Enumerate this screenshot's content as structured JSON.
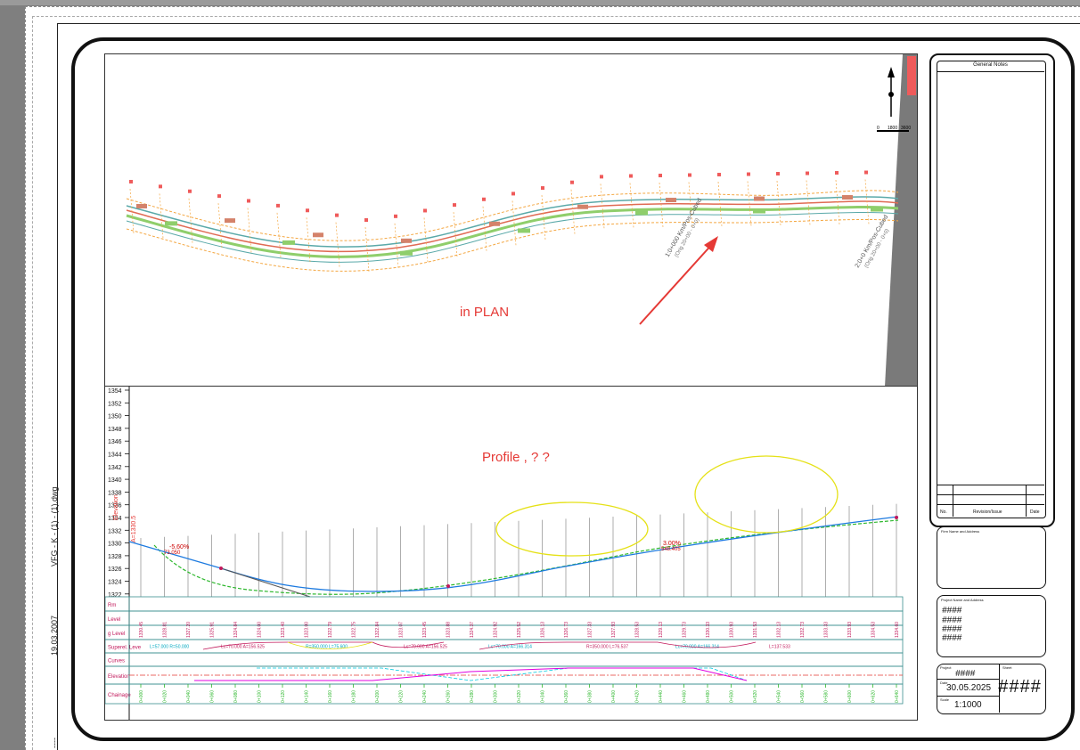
{
  "sheet": {
    "file_name": "VFG - K - (1) - (1).dwg",
    "plot_date": "19.03.2007",
    "side_marks": "----"
  },
  "plan": {
    "annotation": "in PLAN",
    "north_label": "N",
    "scale_bar_labels": [
      "0",
      "1800",
      "3600"
    ],
    "chainage_labels": [
      "1:0+000 Km/Pos-Cubed",
      "(Orig 20+00 - 0+0)",
      "2:0+0 Km/Pos-Cubed",
      "(Orig 20+00 - 0+0)"
    ],
    "road_colors": {
      "edge": "#f4a742",
      "center": "#e06b54",
      "green": "#8fce6b",
      "teal": "#5aa9a9",
      "arrow": "#e53935"
    }
  },
  "profile": {
    "annotation": "Profile ,    ? ?",
    "axis_label": "Elevation",
    "elev_ticks": [
      "1354",
      "1352",
      "1350",
      "1348",
      "1346",
      "1344",
      "1342",
      "1340",
      "1338",
      "1336",
      "1334",
      "1332",
      "1330",
      "1328",
      "1326",
      "1324",
      "1322"
    ],
    "start_label": "A=1330.5",
    "grade_labels": [
      "-5.60%",
      "73.050",
      "3.00%",
      "548.405"
    ],
    "band_labels": [
      "Rm",
      "Level",
      "g Level",
      "Superel. Leve",
      "Curves",
      "Elevation",
      "Chainage"
    ],
    "curve_texts": [
      "L=57.000 R=50.000",
      "Lc=70.000 A=156.525",
      "R=350.000 L=75.600",
      "Lc=70.000 A=156.525",
      "Lc=70.000 A=166.314",
      "R=350.000 L=76.537",
      "Lc=70.000 A=166.314",
      "L=137.533"
    ],
    "chainage_values": [
      "0+000",
      "0+020",
      "0+040",
      "0+060",
      "0+080",
      "0+100",
      "0+120",
      "0+140",
      "0+160",
      "0+180",
      "0+200",
      "0+220",
      "0+240",
      "0+260",
      "0+280",
      "0+300",
      "0+320",
      "0+340",
      "0+360",
      "0+380",
      "0+400",
      "0+420",
      "0+440",
      "0+460",
      "0+480",
      "0+500",
      "0+520",
      "0+540",
      "0+560",
      "0+580",
      "0+600",
      "0+620",
      "0+640"
    ],
    "elevation_values": [
      "1330.45",
      "1328.81",
      "1327.20",
      "1325.91",
      "1324.84",
      "1324.00",
      "1323.40",
      "1323.00",
      "1322.79",
      "1322.75",
      "1322.84",
      "1323.07",
      "1323.45",
      "1323.88",
      "1324.37",
      "1324.92",
      "1325.52",
      "1326.13",
      "1326.73",
      "1327.33",
      "1327.93",
      "1328.53",
      "1329.13",
      "1329.73",
      "1330.33",
      "1330.93",
      "1331.53",
      "1332.13",
      "1332.73",
      "1333.33",
      "1333.93",
      "1334.53",
      "1334.60"
    ],
    "colors": {
      "design": "#1e7be0",
      "ground": "#2eb82e",
      "ellipse": "#e5e117",
      "label": "#e0008a",
      "cyan": "#00c8e0"
    }
  },
  "title_block": {
    "general_notes": "General Notes",
    "revision_col": "Revision/Issue",
    "no_col": "No.",
    "date_col": "Date",
    "firm_label": "Firm Name and Address",
    "project_label": "Project Name and Address",
    "project_hash": "####",
    "project_label2": "Project",
    "project_value": "####",
    "sheet_label": "Sheet",
    "sheet_value": "####",
    "date_label": "Date",
    "date_value": "30.05.2025",
    "scale_label": "Scale",
    "scale_value": "1:1000"
  }
}
